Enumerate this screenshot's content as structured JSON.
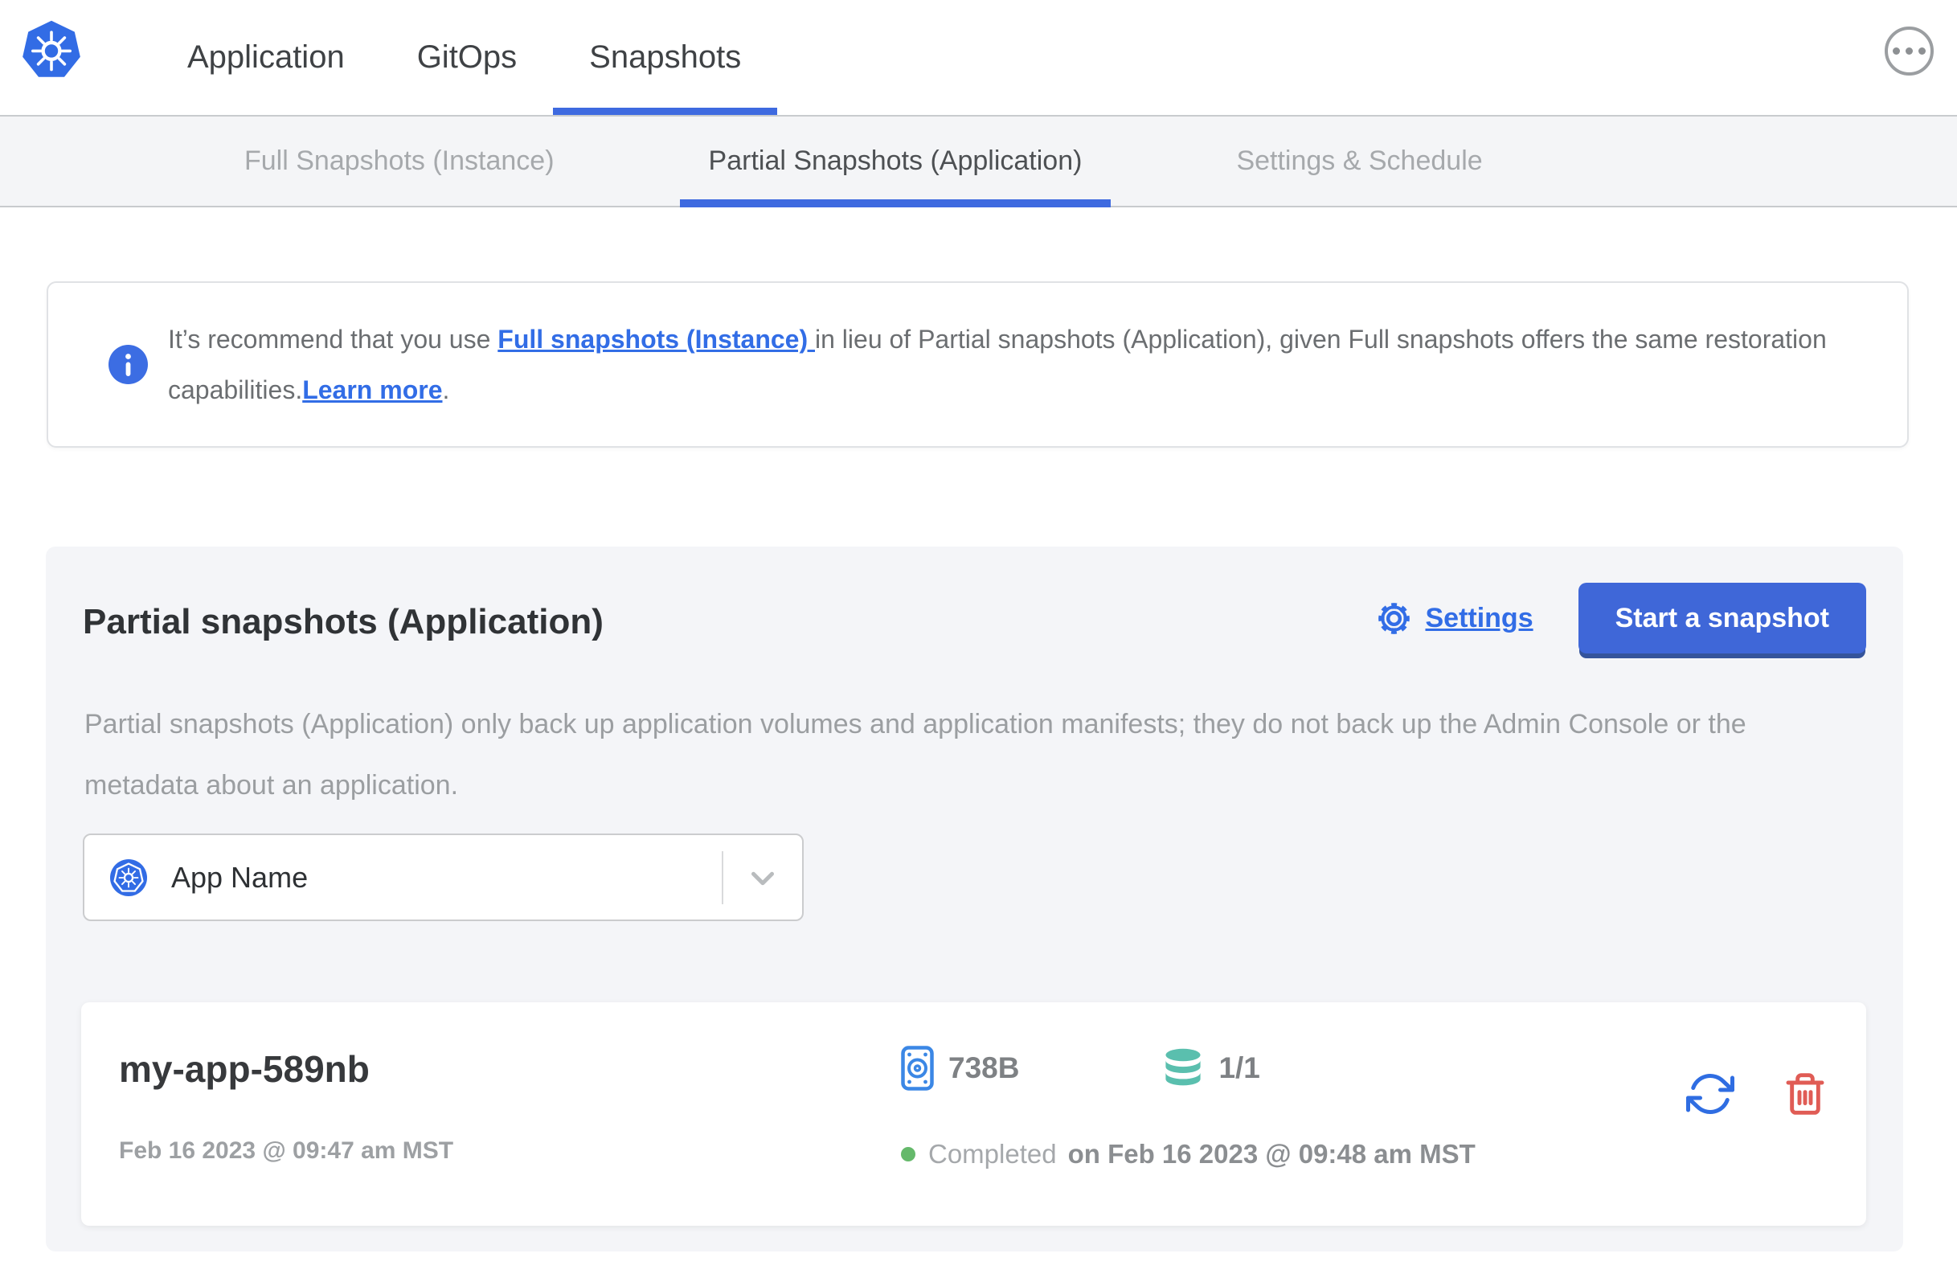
{
  "nav": {
    "items": [
      {
        "label": "Application"
      },
      {
        "label": "GitOps"
      },
      {
        "label": "Snapshots",
        "active": true
      }
    ]
  },
  "tabs": [
    {
      "label": "Full Snapshots (Instance)"
    },
    {
      "label": "Partial Snapshots (Application)",
      "active": true
    },
    {
      "label": "Settings & Schedule"
    }
  ],
  "banner": {
    "text_before": "It’s recommend that you use ",
    "link_full_snapshots": "Full snapshots (Instance) ",
    "text_middle": "in lieu of Partial snapshots (Application), given Full snapshots offers the same restoration capabilities.",
    "link_learn_more": "Learn more",
    "text_after": "."
  },
  "panel": {
    "title": "Partial snapshots (Application)",
    "settings_label": "Settings",
    "start_button_label": "Start a snapshot",
    "description": "Partial snapshots (Application) only back up application volumes and application manifests; they do not back up the Admin Console or the metadata about an application.",
    "app_selector": {
      "value": "App Name"
    }
  },
  "snapshot": {
    "name": "my-app-589nb",
    "started": "Feb 16 2023 @ 09:47 am MST",
    "size": "738B",
    "volumes": "1/1",
    "status": "Completed",
    "finished": "on Feb 16 2023 @ 09:48 am MST"
  },
  "colors": {
    "accent_blue": "#326de6",
    "tab_underline_blue": "#3e6ae0",
    "button_blue": "#3f67d8",
    "volumes_teal": "#5abfae",
    "delete_red": "#e05c55",
    "success_green": "#65b96b"
  }
}
